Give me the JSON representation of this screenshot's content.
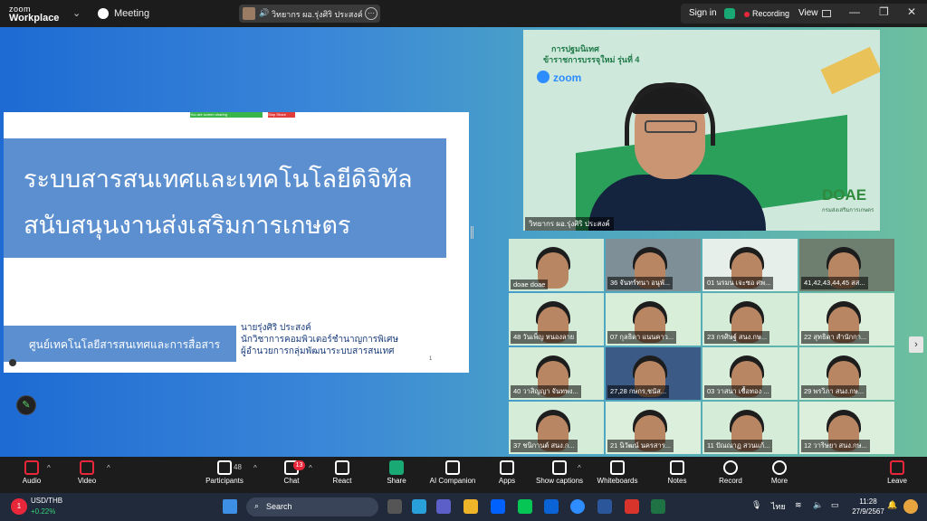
{
  "titlebar": {
    "brand_top": "zoom",
    "brand_main": "Workplace",
    "meeting_label": "Meeting",
    "speaker_pill_text": "วิทยากร ผอ.รุ่งศิริ ประสงค์'s scre",
    "sign_in": "Sign in",
    "recording": "Recording",
    "view": "View"
  },
  "slide": {
    "toolbar_green": "You are screen sharing",
    "toolbar_red": "Stop Share",
    "title_line1": "ระบบสารสนเทศและเทคโนโลยีดิจิทัล",
    "title_line2": "สนับสนุนงานส่งเสริมการเกษตร",
    "unit": "ศูนย์เทคโนโลยีสารสนเทศและการสื่อสาร",
    "presenter_name": "นายรุ่งศิริ ประสงค์",
    "presenter_title1": "นักวิชาการคอมพิวเตอร์ชำนาญการพิเศษ",
    "presenter_title2": "ผู้อำนวยการกลุ่มพัฒนาระบบสารสนเทศ",
    "page_number": "1"
  },
  "speaker": {
    "banner_line1": "การปฐมนิเทศ",
    "banner_line2": "ข้าราชการบรรจุใหม่ รุ่นที่ 4",
    "zoom_logo": "zoom",
    "doae": "DOAE",
    "doae_sub": "กรมส่งเสริมการเกษตร",
    "name_label": "วิทยากร ผอ.รุ่งศิริ ประสงค์",
    "bg_color": "#cfe8dc"
  },
  "gallery": [
    {
      "label": "doae doae",
      "bg": "#cfe9d6"
    },
    {
      "label": "36 จันทร์ทนา อนุพั...",
      "bg": "#7f8f98"
    },
    {
      "label": "01 นรมน เจะซอ ศพ...",
      "bg": "#e6efe9"
    },
    {
      "label": "41,42,43,44,45 สส...",
      "bg": "#6f7f6f"
    },
    {
      "label": "48 วันเพ็ญ หนองลาย",
      "bg": "#d4ecd8"
    },
    {
      "label": "07 กุลธิดา แนนคาว...",
      "bg": "#d9eed9"
    },
    {
      "label": "23 กรศิษฐ์ สนง.กษ...",
      "bg": "#d4ecd8"
    },
    {
      "label": "22 สุทธิดา สำนักกา...",
      "bg": "#dbefdc"
    },
    {
      "label": "40 วาสิญญา จันทพง...",
      "bg": "#d6ecd6"
    },
    {
      "label": "27,28 กษกร,ชนัส...",
      "bg": "#3c5a86"
    },
    {
      "label": "03 วาสนา เชื้อทอง ...",
      "bg": "#d9eddb"
    },
    {
      "label": "29 พรวิภา สนง.กษ...",
      "bg": "#d4ecd8"
    },
    {
      "label": "37 ชนิกานต์ สนง.ก...",
      "bg": "#d4ecd8"
    },
    {
      "label": "21 นิวัฒน์ นครสาร...",
      "bg": "#dbefdc"
    },
    {
      "label": "11 ปัณณาฏ สวนแก้...",
      "bg": "#d4ecd8"
    },
    {
      "label": "12 วาริษยา สนง.กษ...",
      "bg": "#dcefdc"
    }
  ],
  "controls": {
    "audio": "Audio",
    "video": "Video",
    "participants": "Participants",
    "participants_count": "48",
    "chat": "Chat",
    "chat_badge": "13",
    "react": "React",
    "share": "Share",
    "ai_companion": "AI Companion",
    "apps": "Apps",
    "show_captions": "Show captions",
    "whiteboards": "Whiteboards",
    "notes": "Notes",
    "record": "Record",
    "more": "More",
    "leave": "Leave"
  },
  "taskbar": {
    "stock_badge": "1",
    "currency": "USD/THB",
    "change": "+0.22%",
    "search": "Search",
    "language": "ไทย",
    "time": "11:28",
    "date": "27/9/2567"
  }
}
